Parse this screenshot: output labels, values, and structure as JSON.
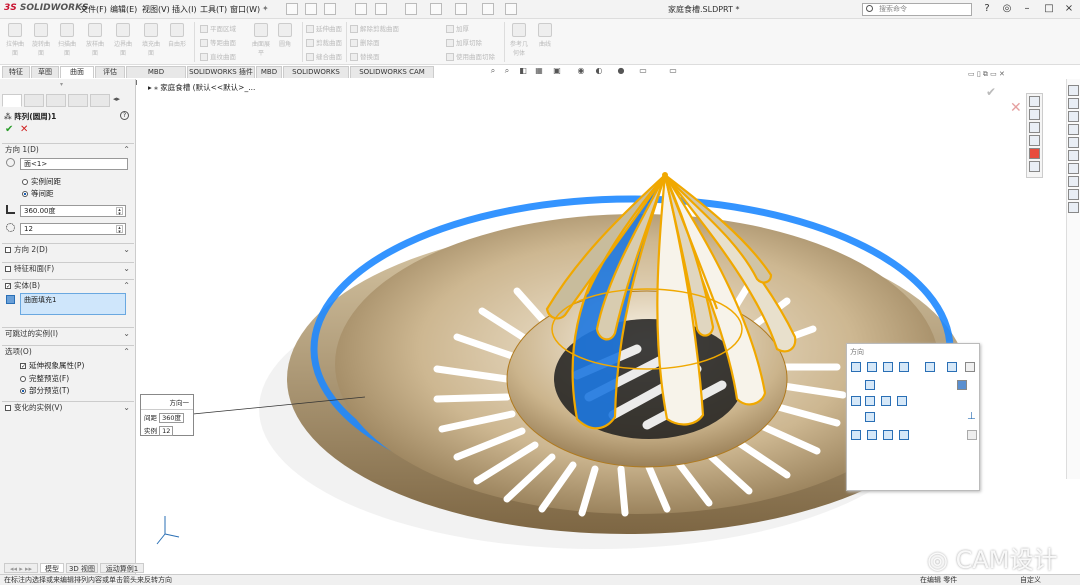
{
  "app": {
    "logo_prefix": "3S",
    "logo": "SOLIDWORKS",
    "doc_title": "家庭食槽.SLDPRT *",
    "search_placeholder": "搜索命令"
  },
  "menu": [
    "文件(F)",
    "编辑(E)",
    "视图(V)",
    "插入(I)",
    "工具(T)",
    "窗口(W)"
  ],
  "ribbon": {
    "big": [
      "拉伸曲面",
      "旋转曲面",
      "扫描曲面",
      "放样曲面",
      "边界曲面",
      "填充曲面",
      "自由形"
    ],
    "col1": [
      "平面区域",
      "等距曲面",
      "直纹曲面"
    ],
    "mid": [
      "曲面展平",
      "圆角"
    ],
    "col2": [
      "延伸曲面",
      "剪裁曲面",
      "缝合曲面"
    ],
    "col3": [
      "解除剪裁曲面",
      "删除面",
      "替换面",
      "加厚",
      "加厚切除",
      "使用曲面切除"
    ],
    "extra": [
      "参考几何体",
      "曲线"
    ]
  },
  "tabs": [
    "特征",
    "草图",
    "曲面",
    "评估",
    "MBD Dimensions",
    "SOLIDWORKS 插件",
    "MBD",
    "SOLIDWORKS CAM",
    "SOLIDWORKS CAM TBM"
  ],
  "active_tab": "曲面",
  "panel": {
    "title": "阵列(圆周)1",
    "dir1": "方向 1(D)",
    "dir1_ref": "面<1>",
    "opt_instance_spacing": "实例间距",
    "opt_equal_spacing": "等间距",
    "angle": "360.00度",
    "count": "12",
    "dir2": "方向 2(D)",
    "features_faces": "特征和面(F)",
    "bodies": "实体(B)",
    "body_item": "曲面填充1",
    "skip_instances": "可跳过的实例(I)",
    "options": "选项(O)",
    "opt_propagate": "延伸视象属性(P)",
    "opt_full_preview": "完整预览(F)",
    "opt_partial_preview": "部分预览(T)",
    "vary_instances": "变化的实例(V)"
  },
  "tree": {
    "label": "家庭食槽 (默认<<默认>_..."
  },
  "callout": {
    "title": "方向一",
    "spacing_label": "间距",
    "spacing_value": "360度",
    "count_label": "实例",
    "count_value": "12"
  },
  "view_panel": {
    "title": "方向"
  },
  "bottom_tabs": [
    "模型",
    "3D 视图",
    "运动算例1"
  ],
  "status": {
    "message": "在标注内选择或来编辑排列内容或单击箭头来反转方向",
    "mode": "在编辑 零件",
    "units": "自定义"
  },
  "watermark": "CAM设计",
  "colors": {
    "accent": "#1a6fd0",
    "shell": "#c9b48f",
    "highlight": "#f0a800",
    "ring": "#1e88ff"
  }
}
